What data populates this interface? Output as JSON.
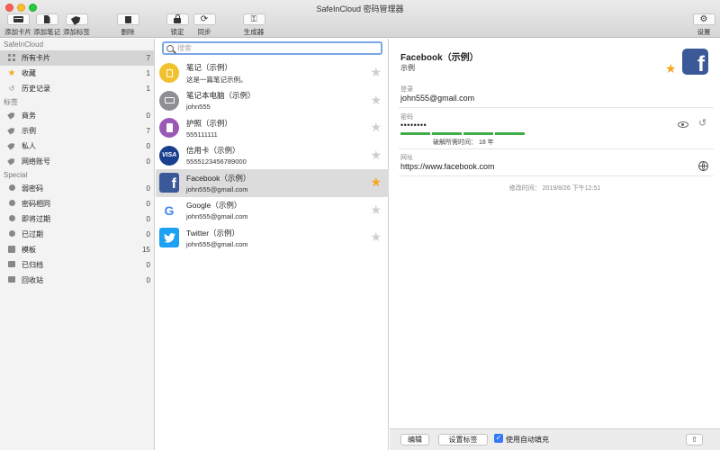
{
  "window": {
    "title": "SafeInCloud 密码管理器"
  },
  "toolbar": {
    "add_card": "添加卡片",
    "add_note": "添加笔记",
    "add_tag": "添加标签",
    "delete": "删除",
    "lock": "锁定",
    "sync": "同步",
    "generator": "生成器",
    "settings": "设置"
  },
  "sidebar": {
    "section1": "SafeInCloud",
    "items1": [
      {
        "label": "所有卡片",
        "count": "7",
        "icon": "grid-icon"
      },
      {
        "label": "收藏",
        "count": "1",
        "icon": "star-icon"
      },
      {
        "label": "历史记录",
        "count": "1",
        "icon": "history-icon"
      }
    ],
    "section2": "标签",
    "items2": [
      {
        "label": "商务",
        "count": "0",
        "icon": "tag-icon"
      },
      {
        "label": "示例",
        "count": "7",
        "icon": "tag-icon"
      },
      {
        "label": "私人",
        "count": "0",
        "icon": "tag-icon"
      },
      {
        "label": "网络账号",
        "count": "0",
        "icon": "tag-icon"
      }
    ],
    "section3": "Special",
    "items3": [
      {
        "label": "弱密码",
        "count": "0",
        "icon": "weak-icon"
      },
      {
        "label": "密码相同",
        "count": "0",
        "icon": "duplicate-icon"
      },
      {
        "label": "即将过期",
        "count": "0",
        "icon": "expiring-icon"
      },
      {
        "label": "已过期",
        "count": "0",
        "icon": "expired-icon"
      },
      {
        "label": "模板",
        "count": "15",
        "icon": "template-icon"
      },
      {
        "label": "已归档",
        "count": "0",
        "icon": "archive-icon"
      },
      {
        "label": "回收站",
        "count": "0",
        "icon": "trash-icon"
      }
    ]
  },
  "search": {
    "placeholder": "搜索",
    "value": ""
  },
  "list": [
    {
      "title": "笔记（示例）",
      "subtitle": "这是一篇笔记示例。",
      "icon": "note-icon",
      "starred": false
    },
    {
      "title": "笔记本电脑（示例）",
      "subtitle": "john555",
      "icon": "laptop-icon",
      "starred": false
    },
    {
      "title": "护照（示例）",
      "subtitle": "555111111",
      "icon": "passport-icon",
      "starred": false
    },
    {
      "title": "信用卡（示例）",
      "subtitle": "5555123456789000",
      "icon": "visa-icon",
      "icon_text": "VISA",
      "starred": false
    },
    {
      "title": "Facebook（示例）",
      "subtitle": "john555@gmail.com",
      "icon": "facebook-icon",
      "icon_text": "f",
      "starred": true,
      "selected": true
    },
    {
      "title": "Google（示例）",
      "subtitle": "john555@gmail.com",
      "icon": "google-icon",
      "icon_text": "G",
      "starred": false
    },
    {
      "title": "Twitter（示例）",
      "subtitle": "john555@gmail.com",
      "icon": "twitter-icon",
      "starred": false
    }
  ],
  "detail": {
    "title": "Facebook（示例）",
    "tag": "示例",
    "logo_text": "f",
    "login_label": "登录",
    "login_value": "john555@gmail.com",
    "password_label": "密码",
    "password_value": "••••••••",
    "crack_time": "破解所需时间： 18 年",
    "url_label": "网址",
    "url_value": "https://www.facebook.com",
    "modified": "修改时间： 2019/8/26 下午12:51"
  },
  "bottom": {
    "edit": "编辑",
    "set_tags": "设置标签",
    "autofill": "使用自动填充",
    "autofill_checked": true
  },
  "colors": {
    "accent": "#3478f6",
    "star": "#f5a623",
    "strength": "#3fae48",
    "facebook": "#3b5998"
  }
}
